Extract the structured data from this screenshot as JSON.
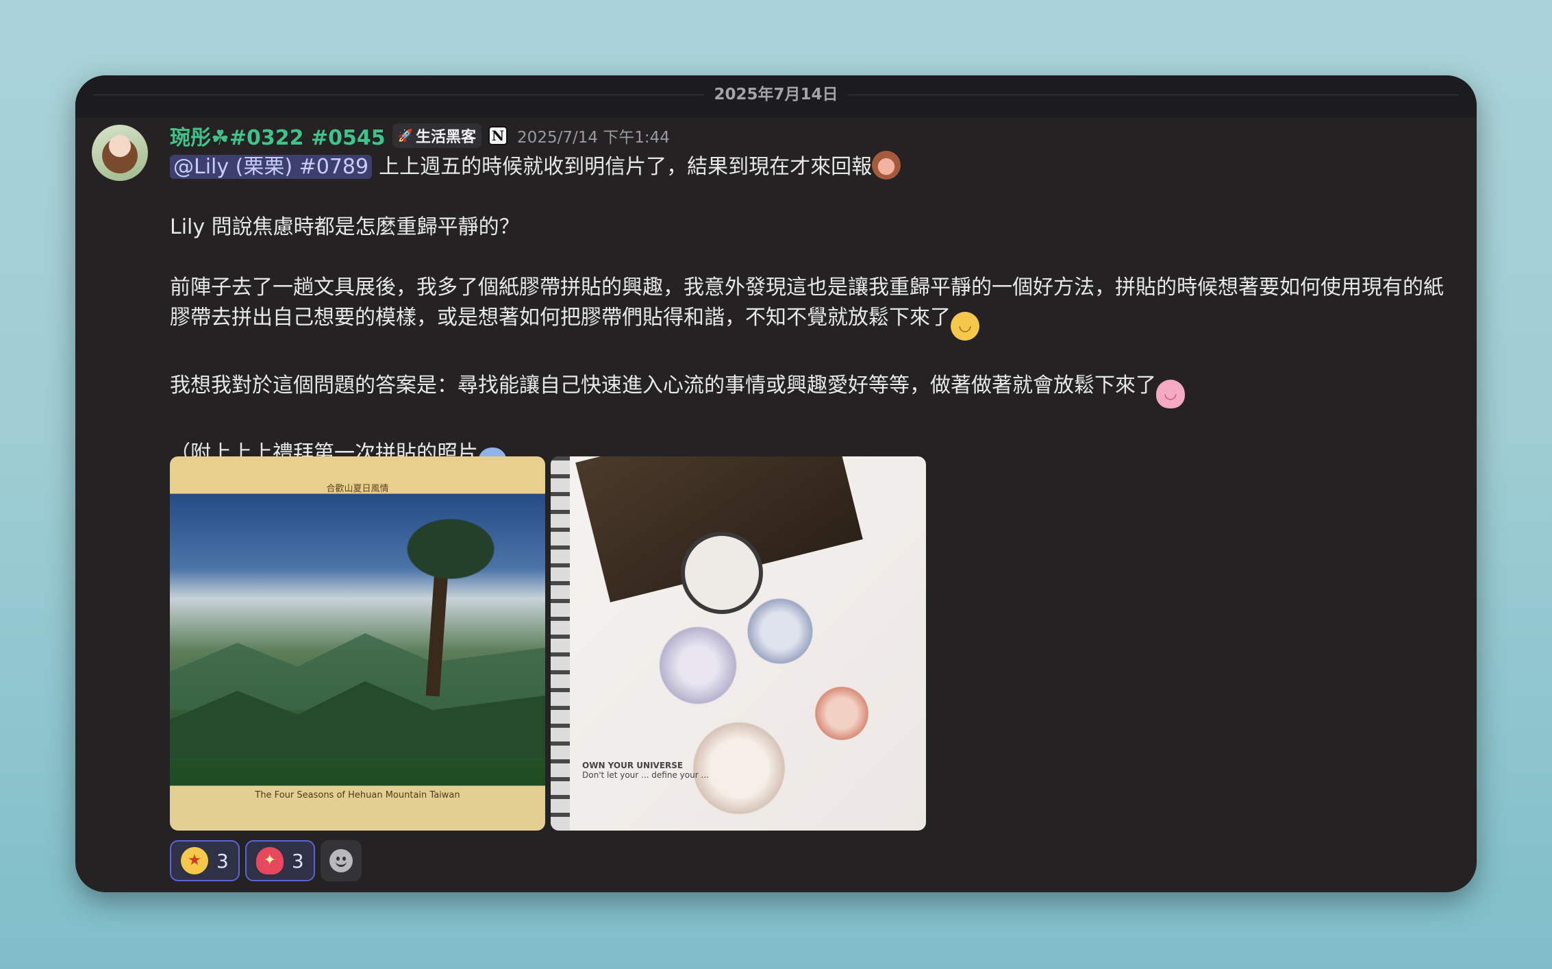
{
  "date_divider": "2025年7月14日",
  "message": {
    "author": "琬彤☘#0322 #0545",
    "role_tag": "生活黑客",
    "timestamp": "2025/7/14 下午1:44",
    "mention": "@Lily (栗栗) #0789",
    "line1": "上上週五的時候就收到明信片了，結果到現在才來回報",
    "line2": "Lily 問說焦慮時都是怎麼重歸平靜的？",
    "line3": "前陣子去了一趟文具展後，我多了個紙膠帶拼貼的興趣，我意外發現這也是讓我重歸平靜的一個好方法，拼貼的時候想著要如何使用現有的紙膠帶去拼出自己想要的模樣，或是想著如何把膠帶們貼得和諧，不知不覺就放鬆下來了",
    "line4": "我想我對於這個問題的答案是：尋找能讓自己快速進入心流的事情或興趣愛好等等，做著做著就會放鬆下來了",
    "line5": "（附上上上禮拜第一次拼貼的照片"
  },
  "attachments": {
    "left": {
      "banner_top": "合歡山夏日風情",
      "banner_bottom": "The Four Seasons of Hehuan Mountain Taiwan"
    },
    "right": {
      "caption_line1": "OWN YOUR UNIVERSE",
      "caption_line2": "Don't let your ... define your ..."
    }
  },
  "reactions": [
    {
      "emoji": "star-struck-icon",
      "count": "3"
    },
    {
      "emoji": "sparkling-heart-icon",
      "count": "3"
    }
  ],
  "colors": {
    "username": "#3fc38a",
    "mention_bg": "#3d3f6e",
    "reaction_border": "#5c63d6"
  }
}
